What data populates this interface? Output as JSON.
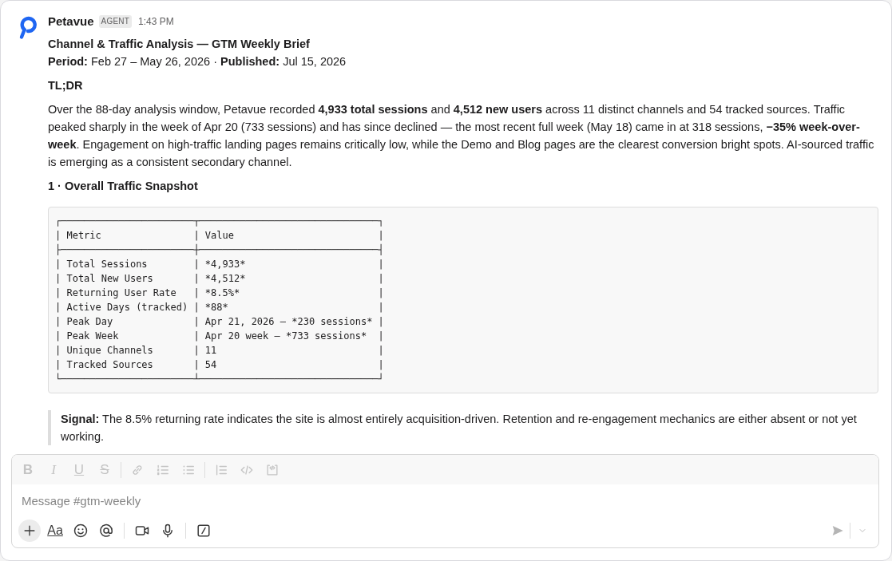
{
  "message": {
    "author": "Petavue",
    "badge": "AGENT",
    "time": "1:43 PM",
    "blocks": [
      {
        "kind": "title",
        "text": "Channel & Traffic Analysis — GTM Weekly Brief"
      },
      {
        "kind": "paragraph",
        "text": "**Period:** Feb 27 – May 26, 2026 · **Published:** Jul 15, 2026"
      },
      {
        "kind": "heading",
        "text": "TL;DR"
      },
      {
        "kind": "paragraph",
        "text": "Over the 88-day analysis window, Petavue recorded **4,933 total sessions** and **4,512 new users** across 11 distinct channels and 54 tracked sources. Traffic peaked sharply in the week of Apr 20 (733 sessions) and has since declined — the most recent full week (May 18) came in at 318 sessions, **−35% week-over-week**. Engagement on high-traffic landing pages remains critically low, while the Demo and Blog pages are the clearest conversion bright spots. AI-sourced traffic is emerging as a consistent secondary channel."
      },
      {
        "kind": "heading",
        "text": "1 · Overall Traffic Snapshot"
      },
      {
        "kind": "code",
        "lines": [
          "┌───────────────────────┬───────────────────────────────┐",
          "| Metric                | Value                         |",
          "├───────────────────────┼───────────────────────────────┤",
          "| Total Sessions        | *4,933*                       |",
          "| Total New Users       | *4,512*                       |",
          "| Returning User Rate   | *8.5%*                        |",
          "| Active Days (tracked) | *88*                          |",
          "| Peak Day              | Apr 21, 2026 — *230 sessions* |",
          "| Peak Week             | Apr 20 week — *733 sessions*  |",
          "| Unique Channels       | 11                            |",
          "| Tracked Sources       | 54                            |",
          "└───────────────────────┴───────────────────────────────┘"
        ]
      },
      {
        "kind": "quote",
        "text": "**Signal:** The 8.5% returning rate indicates the site is almost entirely acquisition-driven. Retention and re-engagement mechanics are either absent or not yet working."
      }
    ]
  },
  "composer": {
    "toolbar_disabled": true,
    "format_buttons": [
      {
        "kind": "bold",
        "label": "B"
      },
      {
        "kind": "italic",
        "label": "I"
      },
      {
        "kind": "underline",
        "label": "U"
      },
      {
        "kind": "strike",
        "label": "S"
      }
    ],
    "placeholder": "Message #gtm-weekly",
    "text_style_label": "Aa",
    "send_disabled": true
  }
}
